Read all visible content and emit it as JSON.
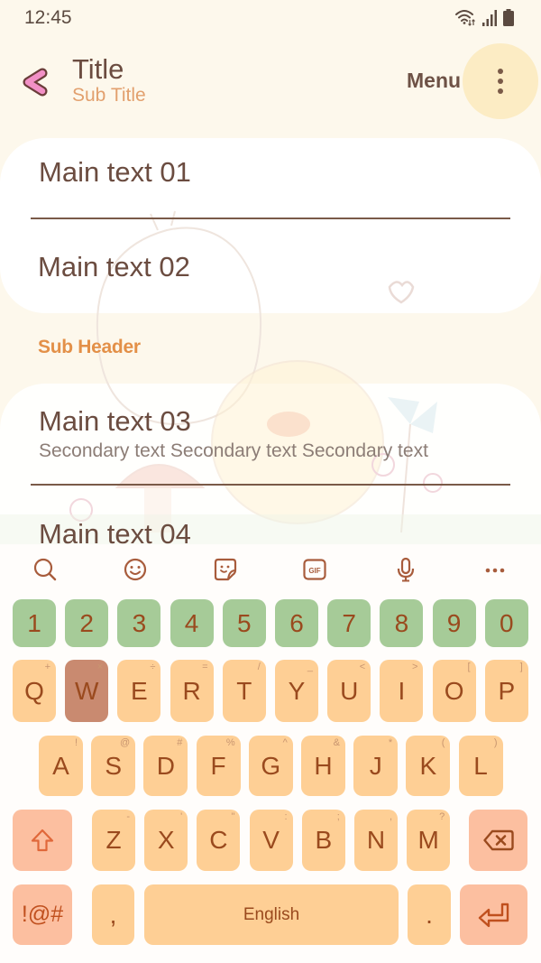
{
  "status_bar": {
    "time": "12:45",
    "icons": [
      "wifi-icon",
      "signal-icon",
      "battery-icon"
    ]
  },
  "app_bar": {
    "back_icon": "back-chevron-icon",
    "title": "Title",
    "subtitle": "Sub Title",
    "menu_label": "Menu",
    "more_icon": "more-vertical-icon"
  },
  "list": {
    "group1": [
      {
        "main": "Main text 01"
      },
      {
        "main": "Main text 02"
      }
    ],
    "sub_header": "Sub Header",
    "group2": [
      {
        "main": "Main text 03",
        "secondary": "Secondary text Secondary text Secondary text"
      },
      {
        "main": "Main text 04"
      }
    ]
  },
  "keyboard": {
    "toolbar": [
      {
        "name": "search",
        "icon": "search-icon"
      },
      {
        "name": "emoji",
        "icon": "emoji-icon"
      },
      {
        "name": "sticker",
        "icon": "sticker-icon"
      },
      {
        "name": "gif",
        "icon": "gif-icon",
        "label": "GIF"
      },
      {
        "name": "voice",
        "icon": "mic-icon"
      },
      {
        "name": "more",
        "icon": "more-horizontal-icon"
      }
    ],
    "number_row": [
      "1",
      "2",
      "3",
      "4",
      "5",
      "6",
      "7",
      "8",
      "9",
      "0"
    ],
    "letter_rows": [
      [
        {
          "label": "Q",
          "hint": "+"
        },
        {
          "label": "W",
          "hint": "×"
        },
        {
          "label": "E",
          "hint": "÷"
        },
        {
          "label": "R",
          "hint": "="
        },
        {
          "label": "T",
          "hint": "/"
        },
        {
          "label": "Y",
          "hint": "_"
        },
        {
          "label": "U",
          "hint": "<"
        },
        {
          "label": "I",
          "hint": ">"
        },
        {
          "label": "O",
          "hint": "["
        },
        {
          "label": "P",
          "hint": "]"
        }
      ],
      [
        {
          "label": "A",
          "hint": "!"
        },
        {
          "label": "S",
          "hint": "@"
        },
        {
          "label": "D",
          "hint": "#"
        },
        {
          "label": "F",
          "hint": "%"
        },
        {
          "label": "G",
          "hint": "^"
        },
        {
          "label": "H",
          "hint": "&"
        },
        {
          "label": "J",
          "hint": "*"
        },
        {
          "label": "K",
          "hint": "("
        },
        {
          "label": "L",
          "hint": ")"
        }
      ],
      [
        {
          "label": "Z",
          "hint": "-"
        },
        {
          "label": "X",
          "hint": "'"
        },
        {
          "label": "C",
          "hint": "\""
        },
        {
          "label": "V",
          "hint": ":"
        },
        {
          "label": "B",
          "hint": ";"
        },
        {
          "label": "N",
          "hint": ","
        },
        {
          "label": "M",
          "hint": "?"
        }
      ]
    ],
    "pressed_key": "W",
    "shift_icon": "shift-icon",
    "backspace_icon": "backspace-icon",
    "symbols_label": "!@#",
    "comma_label": ",",
    "space_label": "English",
    "period_label": ".",
    "enter_icon": "enter-icon"
  },
  "colors": {
    "background": "#fdf8ec",
    "card": "#ffffff",
    "text_primary": "#6b4c40",
    "text_secondary": "#8c7d76",
    "accent": "#e39048",
    "subtitle": "#e2a06e",
    "menu_highlight": "#fcecc4",
    "number_key": "#a6cb98",
    "letter_key": "#fecf95",
    "special_key": "#fcbfa0",
    "pressed_key": "#c98a70",
    "key_text": "#9a4a1e"
  }
}
